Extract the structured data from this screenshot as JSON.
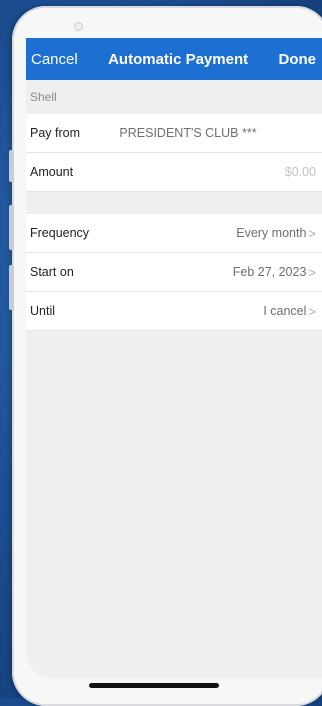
{
  "nav": {
    "cancel": "Cancel",
    "title": "Automatic Payment",
    "done": "Done"
  },
  "payee": "Shell",
  "rows": [
    {
      "label": "Pay from",
      "value": "PRESIDENT'S CLUB ***"
    },
    {
      "label": "Amount",
      "value": "$0.00"
    }
  ],
  "schedule": [
    {
      "label": "Frequency",
      "value": "Every month"
    },
    {
      "label": "Start on",
      "value": "Feb 27, 2023"
    },
    {
      "label": "Until",
      "value": "I cancel"
    }
  ],
  "icons": {
    "chevron": "chevron-right-icon"
  },
  "colors": {
    "nav_bg": "#1d6fd1",
    "background": "#1d4f93"
  }
}
